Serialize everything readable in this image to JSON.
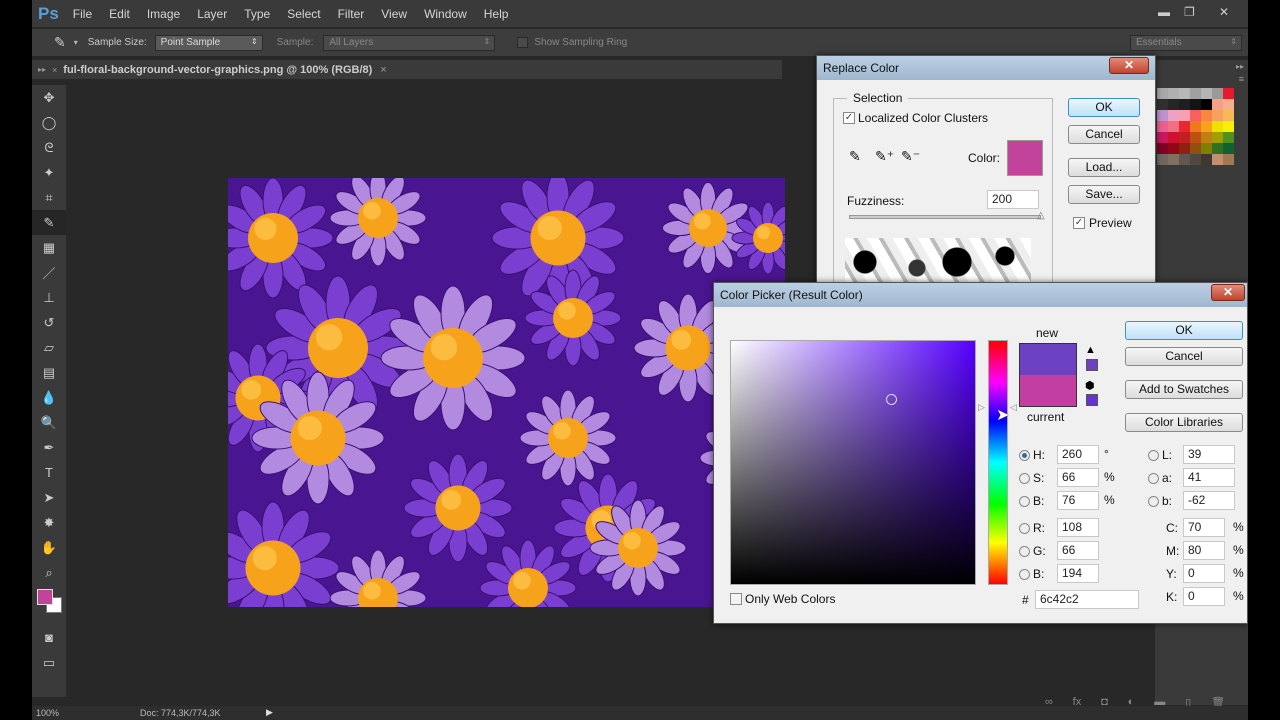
{
  "menubar": {
    "logo": "Ps",
    "items": [
      "File",
      "Edit",
      "Image",
      "Layer",
      "Type",
      "Select",
      "Filter",
      "View",
      "Window",
      "Help"
    ],
    "minimize": "▬",
    "restore": "❐",
    "close": "✕"
  },
  "options": {
    "sample_size_label": "Sample Size:",
    "sample_size_value": "Point Sample",
    "sample_label": "Sample:",
    "sample_value": "All Layers",
    "sampling_ring_label": "Show Sampling Ring",
    "workspace": "Essentials"
  },
  "tab": {
    "title": "ful-floral-background-vector-graphics.png @ 100% (RGB/8)",
    "close": "×"
  },
  "status": {
    "zoom": "100%",
    "doc": "Doc: 774,3K/774,3K"
  },
  "colors": {
    "foreground": "#c2449a",
    "background": "#ffffff",
    "new": "#6c42c2",
    "current": "#c23ea0"
  },
  "swatches": [
    "#a8a8a8",
    "#b0b0b0",
    "#b8b8b8",
    "#a0a0a0",
    "#b4b4b4",
    "#9a9a9a",
    "#e8192c",
    "#303030",
    "#262626",
    "#1e1e1e",
    "#141414",
    "#000000",
    "#f4a08a",
    "#f8b08a",
    "#c090d0",
    "#f0a0c0",
    "#f8a0b0",
    "#f86060",
    "#f88840",
    "#f8a060",
    "#f8b858",
    "#e86090",
    "#f07080",
    "#e82830",
    "#f07820",
    "#f8a020",
    "#f0e000",
    "#f8f000",
    "#c81860",
    "#d01030",
    "#c02020",
    "#c05010",
    "#c08010",
    "#a0a000",
    "#509020",
    "#800028",
    "#900818",
    "#902010",
    "#905010",
    "#808000",
    "#307020",
    "#106030",
    "#706860",
    "#807060",
    "#605850",
    "#504840",
    "#403830",
    "#c09070",
    "#a07858"
  ],
  "replace_color": {
    "title": "Replace Color",
    "selection_label": "Selection",
    "localized_label": "Localized Color Clusters",
    "color_label": "Color:",
    "fuzziness_label": "Fuzziness:",
    "fuzziness_value": "200",
    "fuzziness_fraction": 1.0,
    "ok": "OK",
    "cancel": "Cancel",
    "load": "Load...",
    "save": "Save...",
    "preview_label": "Preview",
    "close": "✕"
  },
  "color_picker": {
    "title": "Color Picker (Result Color)",
    "new_label": "new",
    "current_label": "current",
    "ok": "OK",
    "cancel": "Cancel",
    "add_swatches": "Add to Swatches",
    "color_libraries": "Color Libraries",
    "fields": [
      {
        "label": "H:",
        "value": "260",
        "unit": "°"
      },
      {
        "label": "S:",
        "value": "66",
        "unit": "%"
      },
      {
        "label": "B:",
        "value": "76",
        "unit": "%"
      },
      {
        "label": "R:",
        "value": "108",
        "unit": ""
      },
      {
        "label": "G:",
        "value": "66",
        "unit": ""
      },
      {
        "label": "B:",
        "value": "194",
        "unit": ""
      }
    ],
    "lab": [
      {
        "label": "L:",
        "value": "39"
      },
      {
        "label": "a:",
        "value": "41"
      },
      {
        "label": "b:",
        "value": "-62"
      }
    ],
    "cmyk": [
      {
        "label": "C:",
        "value": "70",
        "unit": "%"
      },
      {
        "label": "M:",
        "value": "80",
        "unit": "%"
      },
      {
        "label": "Y:",
        "value": "0",
        "unit": "%"
      },
      {
        "label": "K:",
        "value": "0",
        "unit": "%"
      }
    ],
    "hex_label": "#",
    "hex": "6c42c2",
    "web_colors_label": "Only Web Colors",
    "close": "✕"
  }
}
